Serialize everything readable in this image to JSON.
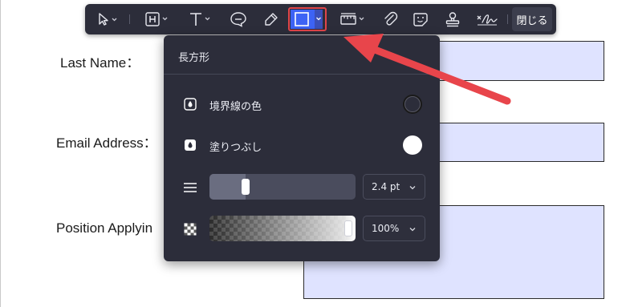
{
  "form": {
    "last_name_label": "Last Name：",
    "email_label": "Email Address：",
    "position_label": "Position Applyin"
  },
  "toolbar": {
    "tools": [
      {
        "name": "select-tool",
        "icon": "cursor-arrow-icon"
      },
      {
        "name": "heading-tool",
        "icon": "heading-box-icon"
      },
      {
        "name": "text-tool",
        "icon": "text-T-icon"
      },
      {
        "name": "comment-tool",
        "icon": "speech-bubble-icon"
      },
      {
        "name": "highlighter-tool",
        "icon": "highlighter-icon"
      },
      {
        "name": "rectangle-tool",
        "icon": "square-icon",
        "active": true
      },
      {
        "name": "measure-tool",
        "icon": "ruler-icon"
      },
      {
        "name": "attach-tool",
        "icon": "paperclip-icon"
      },
      {
        "name": "sticker-tool",
        "icon": "sticker-icon"
      },
      {
        "name": "stamp-tool",
        "icon": "stamp-icon"
      },
      {
        "name": "signature-tool",
        "icon": "signature-icon"
      }
    ],
    "close_label": "閉じる"
  },
  "panel": {
    "title": "長方形",
    "border_color_label": "境界線の色",
    "fill_label": "塗りつぶし",
    "border_color_value": "#1a1a1a",
    "fill_color_value": "#ffffff",
    "line_width_value": "2.4 pt",
    "line_width_fraction": 0.12,
    "opacity_value": "100%",
    "opacity_fraction": 1.0
  },
  "colors": {
    "accent": "#3d63f5",
    "annotation_arrow": "#e8454b",
    "form_box_fill": "#dfe3ff"
  }
}
